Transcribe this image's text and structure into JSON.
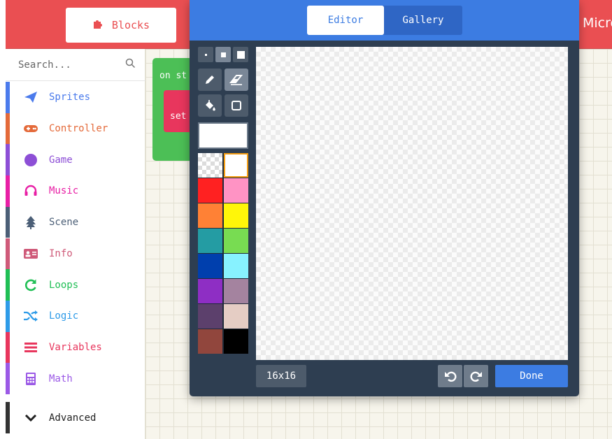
{
  "header": {
    "blocks_tab_label": "Blocks",
    "blocks_icon": "puzzle-icon",
    "title_partial": "Micro"
  },
  "workspace": {
    "on_start_label": "on st",
    "set_label": "set"
  },
  "toolbox": {
    "search_placeholder": "Search...",
    "search_icon": "search-icon",
    "categories": [
      {
        "label": "Sprites",
        "icon": "paper-plane-icon",
        "color": "#4b7bec"
      },
      {
        "label": "Controller",
        "icon": "gamepad-icon",
        "color": "#e46a3a"
      },
      {
        "label": "Game",
        "icon": "circle-icon",
        "color": "#8d4fd6"
      },
      {
        "label": "Music",
        "icon": "headphones-icon",
        "color": "#e81fa5"
      },
      {
        "label": "Scene",
        "icon": "tree-icon",
        "color": "#4c5f77"
      },
      {
        "label": "Info",
        "icon": "id-card-icon",
        "color": "#cf5a79"
      },
      {
        "label": "Loops",
        "icon": "refresh-icon",
        "color": "#20bf55"
      },
      {
        "label": "Logic",
        "icon": "shuffle-icon",
        "color": "#2e9be8"
      },
      {
        "label": "Variables",
        "icon": "list-icon",
        "color": "#e8365d"
      },
      {
        "label": "Math",
        "icon": "calculator-icon",
        "color": "#9b59e6"
      }
    ],
    "advanced_label": "Advanced",
    "advanced_icon": "chevron-down-icon"
  },
  "sprite_editor": {
    "tabs": {
      "editor": "Editor",
      "gallery": "Gallery"
    },
    "tools": [
      "pencil-icon",
      "eraser-icon",
      "fill-icon",
      "rectangle-icon"
    ],
    "brush_sizes": [
      "small",
      "medium",
      "large"
    ],
    "palette": [
      "transparent",
      "#ffffff",
      "#ff2121",
      "#ff93c4",
      "#ff8135",
      "#fff609",
      "#249ca3",
      "#78dc52",
      "#003fad",
      "#87f2ff",
      "#8e2ec4",
      "#a4839f",
      "#5c406c",
      "#e5cdc4",
      "#91463d",
      "#000000"
    ],
    "selected_color": "#ffffff",
    "size_label": "16x16",
    "done_label": "Done"
  }
}
